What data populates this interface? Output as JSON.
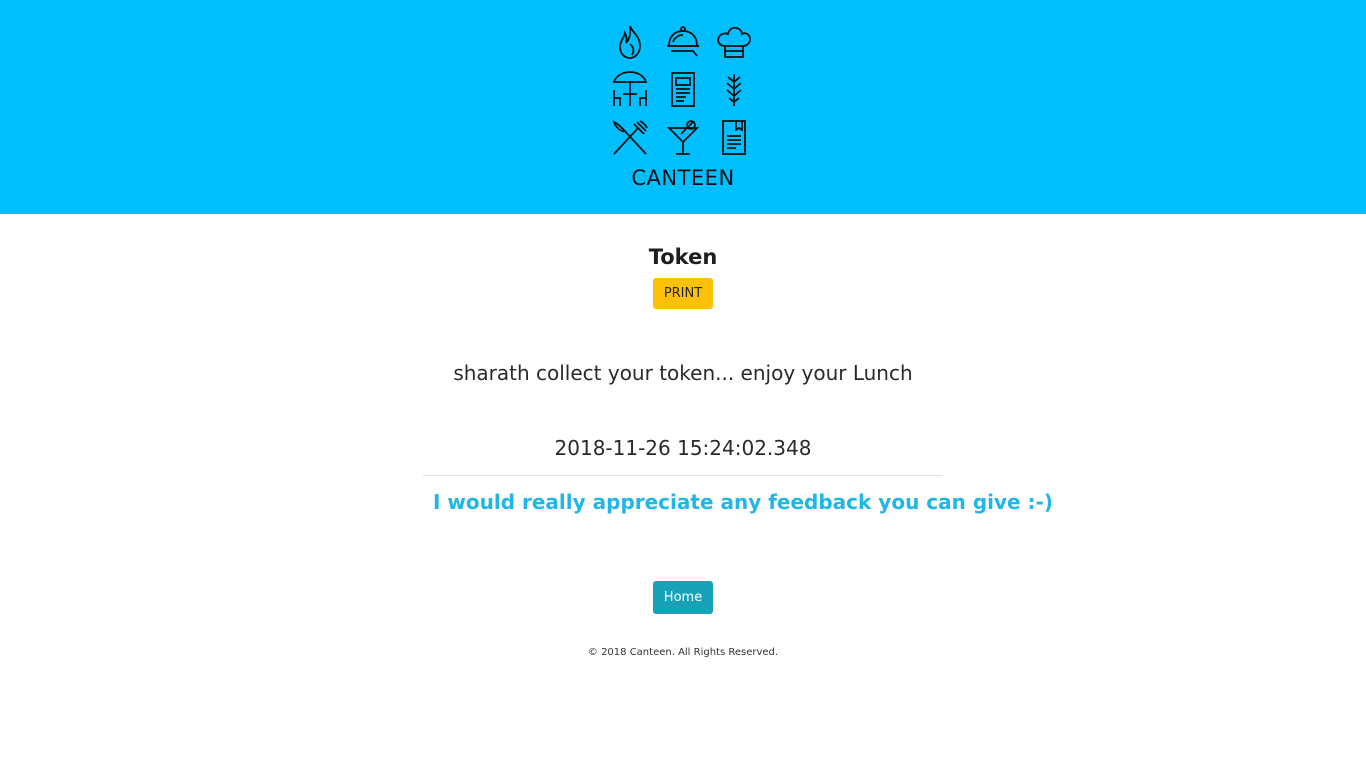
{
  "header": {
    "brand": "CANTEEN",
    "background_color": "#00bfff",
    "logo_icons": [
      "flame-icon",
      "cloche-icon",
      "chef-hat-icon",
      "umbrella-table-icon",
      "menu-card-icon",
      "wheat-icon",
      "fork-knife-icon",
      "cocktail-icon",
      "recipe-book-icon"
    ]
  },
  "main": {
    "title": "Token",
    "print_label": "PRINT",
    "message": "sharath collect your token... enjoy your Lunch",
    "timestamp": "2018-11-26 15:24:02.348",
    "feedback_text": "I would really appreciate any feedback you can give :-)",
    "home_label": "Home"
  },
  "footer": {
    "copyright": "© 2018 Canteen. All Rights Reserved."
  },
  "colors": {
    "print_button": "#ffc107",
    "home_button": "#17a2b8",
    "feedback_link": "#1fb6e8"
  }
}
